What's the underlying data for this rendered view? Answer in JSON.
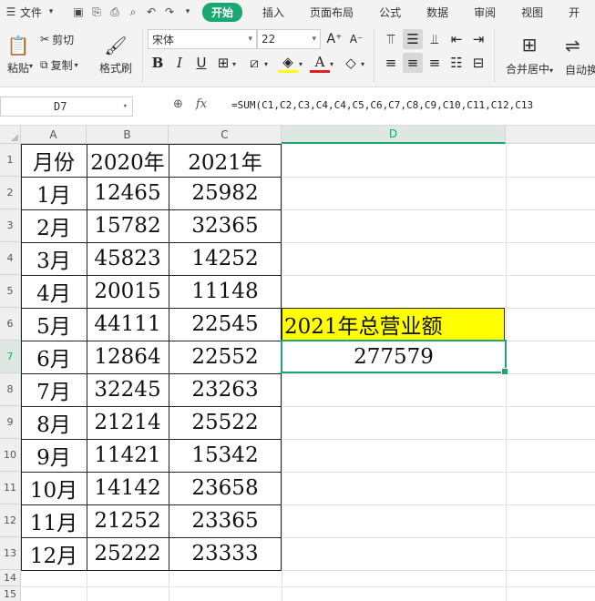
{
  "ribbon_tabs": {
    "file_label": "文件",
    "tabs": [
      "开始",
      "插入",
      "页面布局",
      "公式",
      "数据",
      "审阅",
      "视图",
      "开"
    ]
  },
  "ribbon": {
    "paste_label": "粘贴",
    "cut_label": "剪切",
    "copy_label": "复制",
    "format_painter_label": "格式刷",
    "font_name": "宋体",
    "font_size": "22",
    "merge_label": "合并居中",
    "wrap_label": "自动换"
  },
  "formula_bar": {
    "name_box": "D7",
    "fx_label": "fx",
    "formula": "=SUM(C1,C2,C3,C4,C4,C5,C6,C7,C8,C9,C10,C11,C12,C13"
  },
  "columns": [
    "A",
    "B",
    "C",
    "D"
  ],
  "rows": [
    "1",
    "2",
    "3",
    "4",
    "5",
    "6",
    "7",
    "8",
    "9",
    "10",
    "11",
    "12",
    "13",
    "14",
    "15"
  ],
  "table": {
    "header": [
      "月份",
      "2020年",
      "2021年"
    ],
    "data": [
      [
        "1月",
        "12465",
        "25982"
      ],
      [
        "2月",
        "15782",
        "32365"
      ],
      [
        "3月",
        "45823",
        "14252"
      ],
      [
        "4月",
        "20015",
        "11148"
      ],
      [
        "5月",
        "44111",
        "22545"
      ],
      [
        "6月",
        "12864",
        "22552"
      ],
      [
        "7月",
        "32245",
        "23263"
      ],
      [
        "8月",
        "21214",
        "25522"
      ],
      [
        "9月",
        "11421",
        "15342"
      ],
      [
        "10月",
        "14142",
        "23658"
      ],
      [
        "11月",
        "21252",
        "23365"
      ],
      [
        "12月",
        "25222",
        "23333"
      ]
    ]
  },
  "summary": {
    "label": "2021年总营业额",
    "value": "277579"
  },
  "colors": {
    "accent": "#1aa772",
    "highlight": "#ffff00"
  }
}
